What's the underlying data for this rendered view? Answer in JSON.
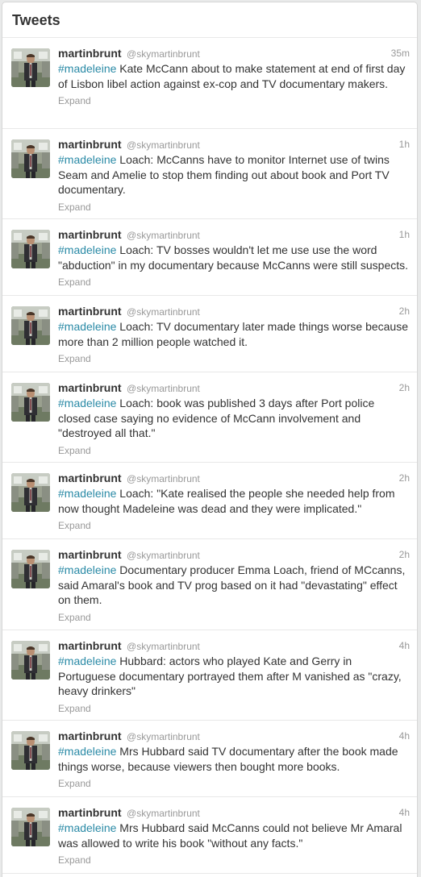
{
  "header": {
    "title": "Tweets"
  },
  "tweets": [
    {
      "name": "martinbrunt",
      "handle": "@skymartinbrunt",
      "time": "35m",
      "hashtag": "#madeleine",
      "text": " Kate McCann about to make statement at end of first day of Lisbon  libel action against ex-cop and TV documentary makers.",
      "expand": "Expand"
    },
    {
      "name": "martinbrunt",
      "handle": "@skymartinbrunt",
      "time": "1h",
      "hashtag": "#madeleine",
      "text": " Loach: McCanns have to monitor Internet use of twins Seam and Amelie to stop them finding out about book and Port TV documentary.",
      "expand": "Expand"
    },
    {
      "name": "martinbrunt",
      "handle": "@skymartinbrunt",
      "time": "1h",
      "hashtag": "#madeleine",
      "text": " Loach: TV bosses wouldn't let me use use the word \"abduction\" in my documentary because McCanns were still suspects.",
      "expand": "Expand"
    },
    {
      "name": "martinbrunt",
      "handle": "@skymartinbrunt",
      "time": "2h",
      "hashtag": "#madeleine",
      "text": " Loach: TV documentary later made things worse because more than 2 million people watched it.",
      "expand": "Expand"
    },
    {
      "name": "martinbrunt",
      "handle": "@skymartinbrunt",
      "time": "2h",
      "hashtag": "#madeleine",
      "text": " Loach: book was published 3 days after Port police closed case saying no evidence of McCann involvement and \"destroyed all that.\"",
      "expand": "Expand"
    },
    {
      "name": "martinbrunt",
      "handle": "@skymartinbrunt",
      "time": "2h",
      "hashtag": "#madeleine",
      "text": " Loach: \"Kate realised the people she needed help from now thought Madeleine was dead and they were implicated.\"",
      "expand": "Expand"
    },
    {
      "name": "martinbrunt",
      "handle": "@skymartinbrunt",
      "time": "2h",
      "hashtag": "#madeleine",
      "text": " Documentary producer Emma Loach, friend of MCcanns, said Amaral's book and TV prog based on it had \"devastating\" effect on them.",
      "expand": "Expand"
    },
    {
      "name": "martinbrunt",
      "handle": "@skymartinbrunt",
      "time": "4h",
      "hashtag": "#madeleine",
      "text": " Hubbard: actors who played Kate and Gerry in Portuguese documentary portrayed them after M vanished as \"crazy, heavy drinkers\"",
      "expand": "Expand"
    },
    {
      "name": "martinbrunt",
      "handle": "@skymartinbrunt",
      "time": "4h",
      "hashtag": "#madeleine",
      "text": " Mrs Hubbard said TV documentary after the book made things worse, because viewers then bought more books.",
      "expand": "Expand"
    },
    {
      "name": "martinbrunt",
      "handle": "@skymartinbrunt",
      "time": "4h",
      "hashtag": "#madeleine",
      "text": " Mrs Hubbard said McCanns could not believe Mr Amaral was allowed to write his book \"without any facts.\"",
      "expand": "Expand"
    }
  ],
  "colors": {
    "hashtag": "#2a8aa6",
    "meta": "#999999",
    "text": "#333333"
  }
}
